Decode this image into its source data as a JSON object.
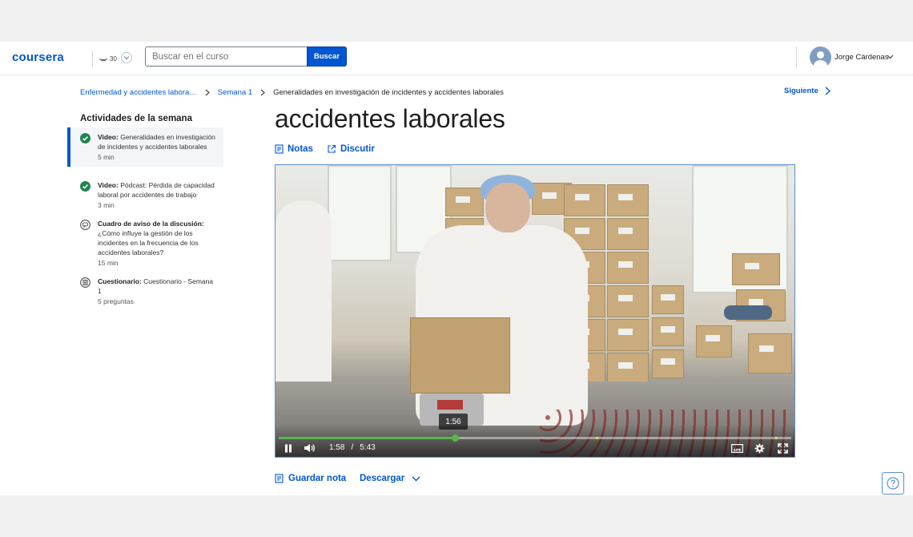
{
  "header": {
    "logo": "coursera",
    "partner_badge": "30",
    "search_placeholder": "Buscar en el curso",
    "search_button": "Buscar",
    "user_name": "Jorge Cárdenas"
  },
  "breadcrumb": {
    "course": "Enfermedad y accidentes labora…",
    "week": "Semana 1",
    "current": "Generalidades en investigación de incidentes y accidentes laborales",
    "next_label": "Siguiente"
  },
  "sidebar": {
    "title": "Actividades de la semana",
    "items": [
      {
        "type": "Video:",
        "name": "Generalidades en investigación de incidentes y accidentes laborales",
        "duration": "5 min",
        "icon": "check-circle-icon",
        "active": true
      },
      {
        "type": "Video:",
        "name": "Pódcast: Pérdida de capacidad laboral por accidentes de trabajo",
        "duration": "3 min",
        "icon": "check-circle-icon",
        "active": false
      },
      {
        "type": "Cuadro de aviso de la discusión:",
        "name": "¿Cómo influye la gestión de los incidentes en la frecuencia de los accidentes laborales?",
        "duration": "15 min",
        "icon": "discussion-icon",
        "active": false
      },
      {
        "type": "Cuestionario:",
        "name": "Cuestionario - Semana 1",
        "duration": "5 preguntas",
        "icon": "quiz-icon",
        "active": false
      }
    ]
  },
  "main": {
    "title": "accidentes laborales",
    "tools": {
      "notes": "Notas",
      "discuss": "Discutir"
    },
    "video": {
      "current_time": "1:58",
      "separator": "/",
      "duration": "5:43",
      "hover_time": "1:56",
      "progress_fraction": 0.344
    },
    "below": {
      "save_note": "Guardar nota",
      "download": "Descargar"
    }
  },
  "colors": {
    "brand": "#0056d2",
    "progress": "#5ab54e",
    "complete": "#1f8354"
  }
}
